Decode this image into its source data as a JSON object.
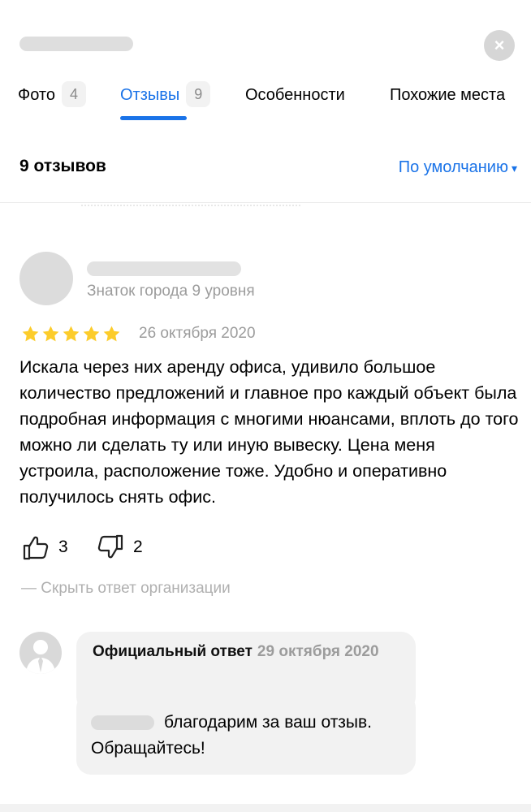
{
  "header": {
    "close_icon": "×"
  },
  "tabs": [
    {
      "label": "Фото",
      "count": "4"
    },
    {
      "label": "Отзывы",
      "count": "9"
    },
    {
      "label": "Особенности",
      "count": ""
    },
    {
      "label": "Похожие места",
      "count": ""
    }
  ],
  "active_tab": "Отзывы",
  "reviews_header": {
    "count_title": "9 отзывов",
    "sort_label": "По умолчанию",
    "sort_caret": "▾"
  },
  "review": {
    "author_level": "Знаток города 9 уровня",
    "rating": 5,
    "date": "26 октября 2020",
    "text": "Искала через них аренду офиса, удивило большое количество предложений и главное про каждый объект была подробная информация с многими нюансами, вплоть до того можно ли сделать ту или иную вывеску. Цена меня устроила, расположение тоже. Удобно и оперативно получилось снять офис.",
    "likes": "3",
    "dislikes": "2",
    "hide_answer_label": "— Скрыть ответ организации"
  },
  "official_answer": {
    "label": "Официальный ответ",
    "date": "29 октября 2020",
    "text": "благодарим за ваш отзыв. Обращайтесь!"
  },
  "colors": {
    "accent": "#1a73e8",
    "star": "#fccc2b",
    "muted_text": "#9c9c9c"
  }
}
